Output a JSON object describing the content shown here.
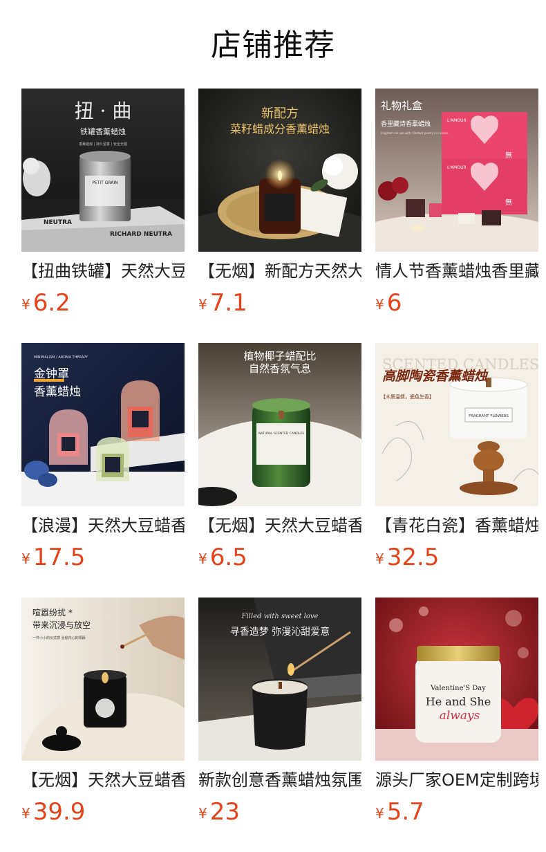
{
  "page": {
    "title": "店铺推荐"
  },
  "currency": "¥",
  "products": [
    {
      "name": "【扭曲铁罐】天然大豆蜡",
      "price": "6.2",
      "image": {
        "headline": "扭 · 曲",
        "subtitle": "铁罐香薰蜡烛",
        "caption": "香薰蜡烛 | 持久留香 | 安全无烟",
        "label": "PETIT GRAIN",
        "book": "RICHARD NEUTRA"
      }
    },
    {
      "name": "【无烟】新配方天然大豆",
      "price": "7.1",
      "image": {
        "headline": "新配方",
        "subtitle": "菜籽蜡成分香薰蜡烛"
      }
    },
    {
      "name": "情人节香薰蜡烛香里藏诗",
      "price": "6",
      "image": {
        "headline": "礼物礼盒",
        "subtitle": "香里藏诗香薰蜡烛",
        "caption": "Fragrant can see with / Distant poetry in incense",
        "box_label": "L'AMOUR",
        "box_glyph": "無"
      }
    },
    {
      "name": "【浪漫】天然大豆蜡香薰",
      "price": "17.5",
      "image": {
        "eyebrow": "MINIMALISM / AROMA THERAPY",
        "headline": "金钟罩",
        "subtitle": "香薰蜡烛"
      }
    },
    {
      "name": "【无烟】天然大豆蜡香薰",
      "price": "6.5",
      "image": {
        "headline": "植物椰子蜡配比",
        "subtitle": "自然香氛气息",
        "label": "NATURAL SCENTED CANDLES"
      }
    },
    {
      "name": "【青花白瓷】香薰蜡烛",
      "price": "32.5",
      "image": {
        "eyebrow": "SCENTED CANDLES",
        "headline": "高脚陶瓷香薰蜡烛",
        "subtitle": "【木质温情，瓷色生香】",
        "label": "FRAGRANT FLOWERS"
      }
    },
    {
      "name": "【无烟】天然大豆蜡香薰",
      "price": "39.9",
      "image": {
        "headline": "喧嚣纷扰 *",
        "subtitle": "带来沉浸与放空",
        "caption": "一件小小的仪式感 治愈内心的烦躁"
      }
    },
    {
      "name": "新款创意香薰蜡烛氛围感",
      "price": "23",
      "image": {
        "eyebrow": "Filled with sweet love",
        "headline": "寻香造梦  弥漫沁甜爱意"
      }
    },
    {
      "name": "源头厂家OEM定制跨境",
      "price": "5.7",
      "image": {
        "line1": "Valentine'S Day",
        "line2": "He and She",
        "line3": "always"
      }
    }
  ],
  "colors": {
    "price": "#e4441b",
    "title": "#111111"
  }
}
